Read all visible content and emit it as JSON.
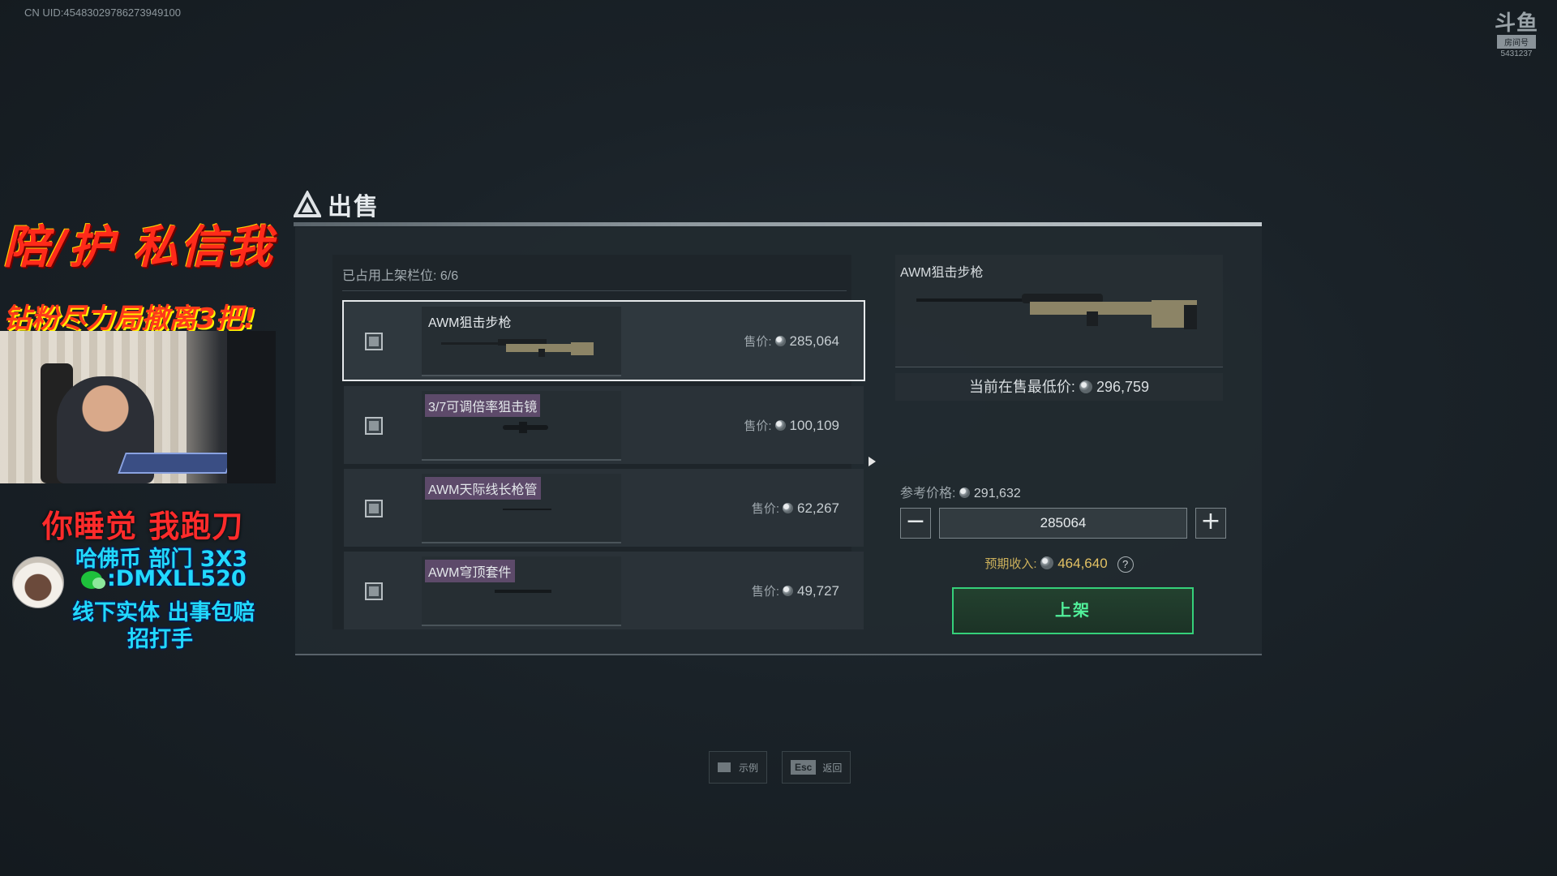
{
  "uid": "CN UID:4548302978627394910​0",
  "logo": {
    "mark": "斗鱼",
    "sub": "房间号",
    "room": "5431237"
  },
  "overlay": {
    "promo1": "陪/护 私信我",
    "promo2": "钻粉尽力局撤离3把!",
    "promo3": "你睡觉 我跑刀",
    "line1": "哈佛币 部门 3X3",
    "line2": ":DMXLL520",
    "line3": "线下实体 出事包赔",
    "line4": "招打手"
  },
  "dialog": {
    "title": "出售",
    "slots_label": "已占用上架栏位: 6/6",
    "price_label": "售价:",
    "items": [
      {
        "name": "AWM狙击步枪",
        "price": "285,064",
        "selected": true
      },
      {
        "name": "3/7可调倍率狙击镜",
        "price": "100,109",
        "selected": false
      },
      {
        "name": "AWM天际线长枪管",
        "price": "62,267",
        "selected": false
      },
      {
        "name": "AWM穹顶套件",
        "price": "49,727",
        "selected": false
      }
    ],
    "detail": {
      "title": "AWM狙击步枪",
      "lowest_label": "当前在售最低价:",
      "lowest_value": "296,759",
      "ref_label": "参考价格:",
      "ref_value": "291,632",
      "quantity": "285064",
      "income_label": "预期收入:",
      "income_value": "464,640",
      "help": "?",
      "list_button": "上架"
    }
  },
  "hints": {
    "example": "示例",
    "esc_key": "Esc",
    "back": "返回"
  },
  "colors": {
    "accent_green": "#35d07a",
    "income_gold": "#e4c264",
    "tag_purple": "#5d4a6a"
  }
}
